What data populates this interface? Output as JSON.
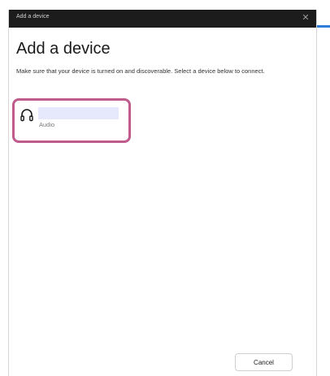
{
  "window": {
    "title": "Add a device",
    "close_glyph": "✕"
  },
  "main": {
    "heading": "Add a device",
    "instructions": "Make sure that your device is turned on and discoverable. Select a device below to connect."
  },
  "devices": [
    {
      "name": "",
      "type": "Audio",
      "icon": "headphones-icon"
    }
  ],
  "footer": {
    "cancel_label": "Cancel"
  },
  "colors": {
    "titlebar": "#1c1c1c",
    "highlight_outline": "#c05b8e",
    "device_name_fill": "#e6e8fb",
    "accent": "#2f7bd8"
  }
}
